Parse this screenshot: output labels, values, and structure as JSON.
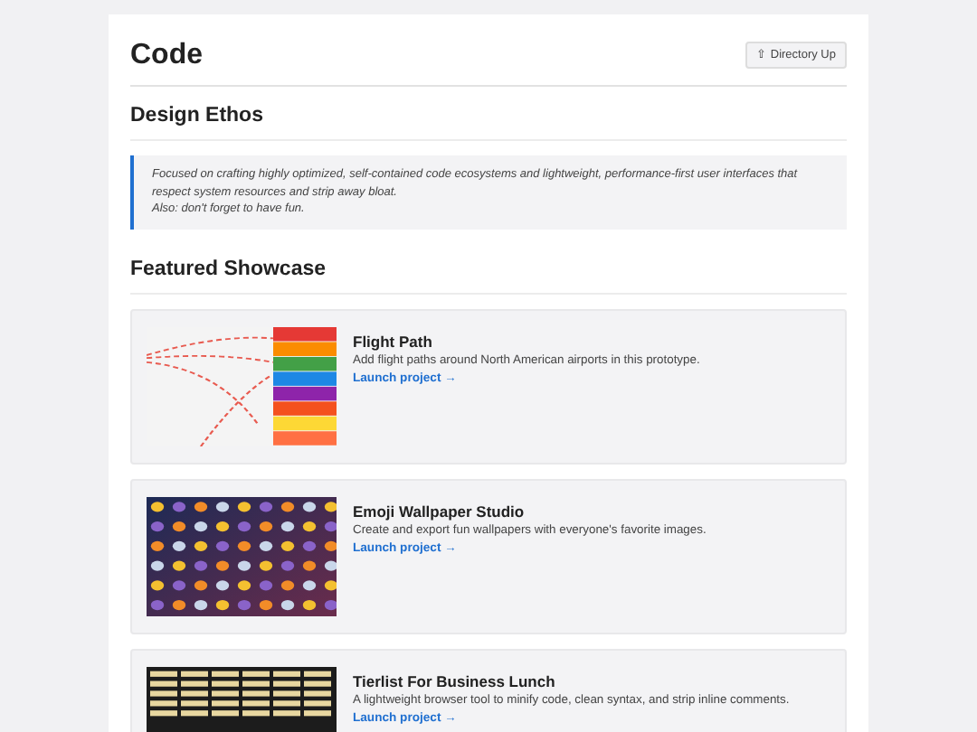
{
  "header": {
    "title": "Code",
    "button": "⇧ Directory Up"
  },
  "ethos": {
    "heading": "Design Ethos",
    "lines": [
      "Focused on crafting highly optimized, self-contained code ecosystems and lightweight, performance-first user interfaces that respect system resources and strip away bloat.",
      "Also: don't forget to have fun."
    ]
  },
  "showcase": {
    "heading": "Featured Showcase",
    "projects": [
      {
        "kind": "map",
        "title": "Flight Path",
        "description": "Add flight paths around North American airports in this prototype.",
        "link": "Launch project →"
      },
      {
        "kind": "pattern",
        "title": "Emoji Wallpaper Studio",
        "description": "Create and export fun wallpapers with everyone's favorite images.",
        "link": "Launch project →"
      },
      {
        "kind": "dark",
        "title": "Tierlist For Business Lunch",
        "description": "A lightweight browser tool to minify code, clean syntax, and strip inline comments.",
        "link": "Launch project →"
      }
    ]
  }
}
